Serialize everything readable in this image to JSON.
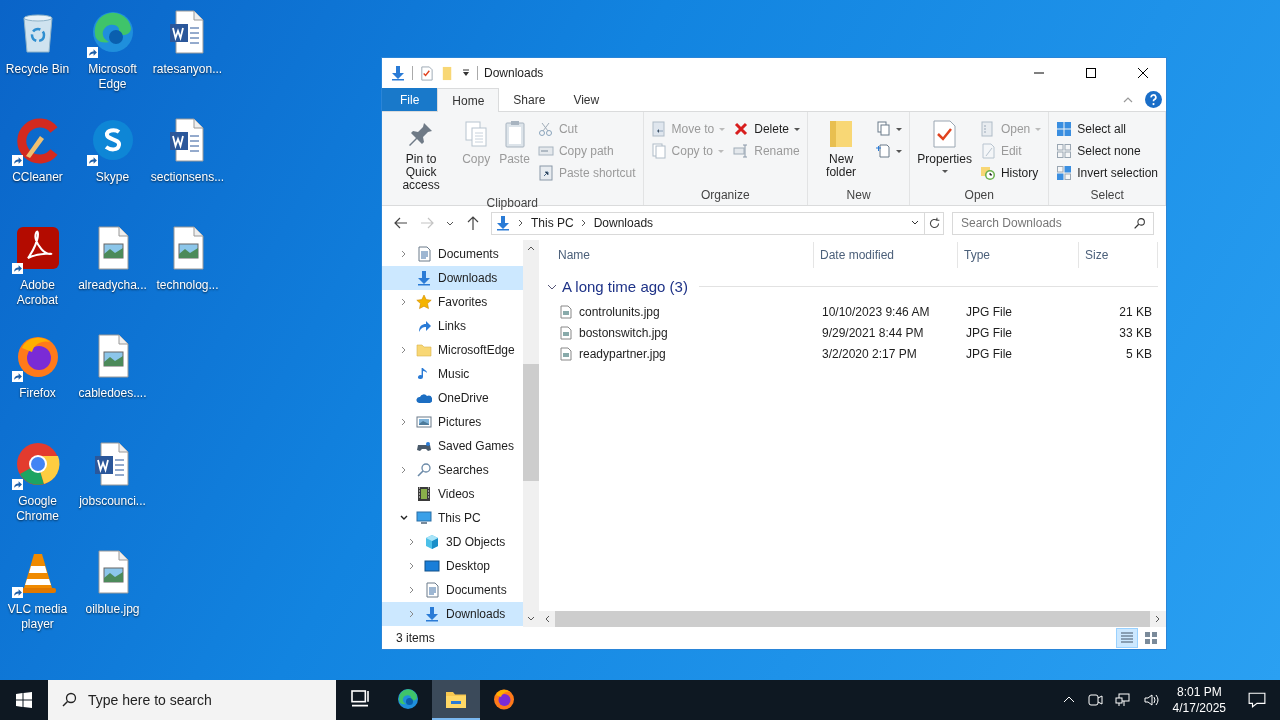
{
  "desktop_icons": [
    {
      "label": "Recycle Bin",
      "kind": "recycle",
      "shortcut": false
    },
    {
      "label": "CCleaner",
      "kind": "ccleaner",
      "shortcut": true
    },
    {
      "label": "Adobe Acrobat",
      "kind": "acrobat",
      "shortcut": true
    },
    {
      "label": "Firefox",
      "kind": "firefox",
      "shortcut": true
    },
    {
      "label": "Google Chrome",
      "kind": "chrome",
      "shortcut": true
    },
    {
      "label": "VLC media player",
      "kind": "vlc",
      "shortcut": true
    },
    {
      "label": "Microsoft Edge",
      "kind": "edge",
      "shortcut": true
    },
    {
      "label": "Skype",
      "kind": "skype",
      "shortcut": true
    },
    {
      "label": "alreadycha...",
      "kind": "image",
      "shortcut": false
    },
    {
      "label": "cabledoes....",
      "kind": "image",
      "shortcut": false
    },
    {
      "label": "jobscounci...",
      "kind": "word",
      "shortcut": false
    },
    {
      "label": "oilblue.jpg",
      "kind": "image",
      "shortcut": false
    },
    {
      "label": "ratesanyon...",
      "kind": "word",
      "shortcut": false
    },
    {
      "label": "sectionsens...",
      "kind": "word",
      "shortcut": false
    },
    {
      "label": "technolog...",
      "kind": "image",
      "shortcut": false
    }
  ],
  "window": {
    "title": "Downloads",
    "tabs": [
      {
        "label": "File",
        "kind": "menu",
        "selected": false
      },
      {
        "label": "Home",
        "kind": "tab",
        "selected": true
      },
      {
        "label": "Share",
        "kind": "tab",
        "selected": false
      },
      {
        "label": "View",
        "kind": "tab",
        "selected": false
      }
    ],
    "ribbon": {
      "groups": [
        {
          "label": "Clipboard",
          "columns": [
            [
              {
                "kind": "large",
                "label": "Pin to Quick access",
                "disabled": false,
                "dropdown": false
              }
            ],
            [
              {
                "kind": "large",
                "label": "Copy",
                "disabled": true,
                "dropdown": false
              }
            ],
            [
              {
                "kind": "large",
                "label": "Paste",
                "disabled": true,
                "dropdown": false
              }
            ],
            [
              {
                "kind": "small",
                "label": "Cut",
                "disabled": true,
                "dropdown": false
              },
              {
                "kind": "small",
                "label": "Copy path",
                "disabled": true,
                "dropdown": false
              },
              {
                "kind": "small",
                "label": "Paste shortcut",
                "disabled": true,
                "dropdown": false
              }
            ]
          ]
        },
        {
          "label": "Organize",
          "columns": [
            [
              {
                "kind": "small",
                "label": "Move to",
                "disabled": true,
                "dropdown": true
              },
              {
                "kind": "small",
                "label": "Copy to",
                "disabled": true,
                "dropdown": true
              }
            ],
            [
              {
                "kind": "small",
                "label": "Delete",
                "disabled": false,
                "dropdown": true
              },
              {
                "kind": "small",
                "label": "Rename",
                "disabled": true,
                "dropdown": false
              }
            ]
          ]
        },
        {
          "label": "New",
          "columns": [
            [
              {
                "kind": "large",
                "label": "New folder",
                "disabled": false,
                "dropdown": false
              }
            ],
            [
              {
                "kind": "icon",
                "disabled": false,
                "dropdown": true
              },
              {
                "kind": "icon",
                "disabled": false,
                "dropdown": true
              }
            ]
          ]
        },
        {
          "label": "Open",
          "columns": [
            [
              {
                "kind": "large",
                "label": "Properties",
                "disabled": false,
                "dropdown": true
              }
            ],
            [
              {
                "kind": "small",
                "label": "Open",
                "disabled": true,
                "dropdown": true
              },
              {
                "kind": "small",
                "label": "Edit",
                "disabled": true,
                "dropdown": false
              },
              {
                "kind": "small",
                "label": "History",
                "disabled": false,
                "dropdown": false
              }
            ]
          ]
        },
        {
          "label": "Select",
          "columns": [
            [
              {
                "kind": "small",
                "label": "Select all",
                "disabled": false,
                "dropdown": false
              },
              {
                "kind": "small",
                "label": "Select none",
                "disabled": false,
                "dropdown": false
              },
              {
                "kind": "small",
                "label": "Invert selection",
                "disabled": false,
                "dropdown": false
              }
            ]
          ]
        }
      ]
    },
    "address": {
      "path": [
        "This PC",
        "Downloads"
      ],
      "forward_disabled": true
    },
    "search": {
      "placeholder": "Search Downloads"
    },
    "nav_tree": [
      {
        "label": "Documents",
        "kind": "documents",
        "expandable": true,
        "expanded": false,
        "selected": false
      },
      {
        "label": "Downloads",
        "kind": "downloads",
        "expandable": false,
        "selected": true
      },
      {
        "label": "Favorites",
        "kind": "favorites",
        "expandable": true,
        "expanded": false,
        "selected": false
      },
      {
        "label": "Links",
        "kind": "links",
        "expandable": false,
        "selected": false
      },
      {
        "label": "MicrosoftEdge",
        "kind": "folder",
        "expandable": true,
        "expanded": false,
        "selected": false
      },
      {
        "label": "Music",
        "kind": "music",
        "expandable": false,
        "selected": false
      },
      {
        "label": "OneDrive",
        "kind": "onedrive",
        "expandable": false,
        "selected": false
      },
      {
        "label": "Pictures",
        "kind": "pictures",
        "expandable": true,
        "expanded": false,
        "selected": false
      },
      {
        "label": "Saved Games",
        "kind": "games",
        "expandable": false,
        "selected": false
      },
      {
        "label": "Searches",
        "kind": "searches",
        "expandable": true,
        "expanded": false,
        "selected": false
      },
      {
        "label": "Videos",
        "kind": "videos",
        "expandable": false,
        "selected": false
      },
      {
        "label": "This PC",
        "kind": "pc",
        "expandable": true,
        "expanded": true,
        "selected": false,
        "children": [
          {
            "label": "3D Objects",
            "kind": "objects",
            "expandable": true,
            "expanded": false,
            "selected": false
          },
          {
            "label": "Desktop",
            "kind": "desktop",
            "expandable": true,
            "expanded": false,
            "selected": false
          },
          {
            "label": "Documents",
            "kind": "documents",
            "expandable": true,
            "expanded": false,
            "selected": false
          },
          {
            "label": "Downloads",
            "kind": "downloads",
            "expandable": true,
            "expanded": false,
            "selected": true
          }
        ]
      }
    ],
    "files": {
      "columns": [
        "Name",
        "Date modified",
        "Type",
        "Size"
      ],
      "groups": [
        {
          "label": "A long time ago (3)",
          "expanded": true,
          "rows": [
            [
              "controlunits.jpg",
              "10/10/2023 9:46 AM",
              "JPG File",
              "21 KB"
            ],
            [
              "bostonswitch.jpg",
              "9/29/2021 8:44 PM",
              "JPG File",
              "33 KB"
            ],
            [
              "readypartner.jpg",
              "3/2/2020 2:17 PM",
              "JPG File",
              "5 KB"
            ]
          ]
        }
      ]
    },
    "status_bar": {
      "text": "3 items",
      "views": [
        {
          "kind": "details",
          "selected": true
        },
        {
          "kind": "tiles",
          "selected": false
        }
      ]
    }
  },
  "taskbar": {
    "search_placeholder": "Type here to search",
    "apps": [
      {
        "kind": "taskview",
        "active": false
      },
      {
        "kind": "edge",
        "active": false
      },
      {
        "kind": "explorer",
        "active": true
      },
      {
        "kind": "firefox",
        "active": false
      }
    ],
    "time": "8:01 PM",
    "date": "4/17/2025"
  }
}
